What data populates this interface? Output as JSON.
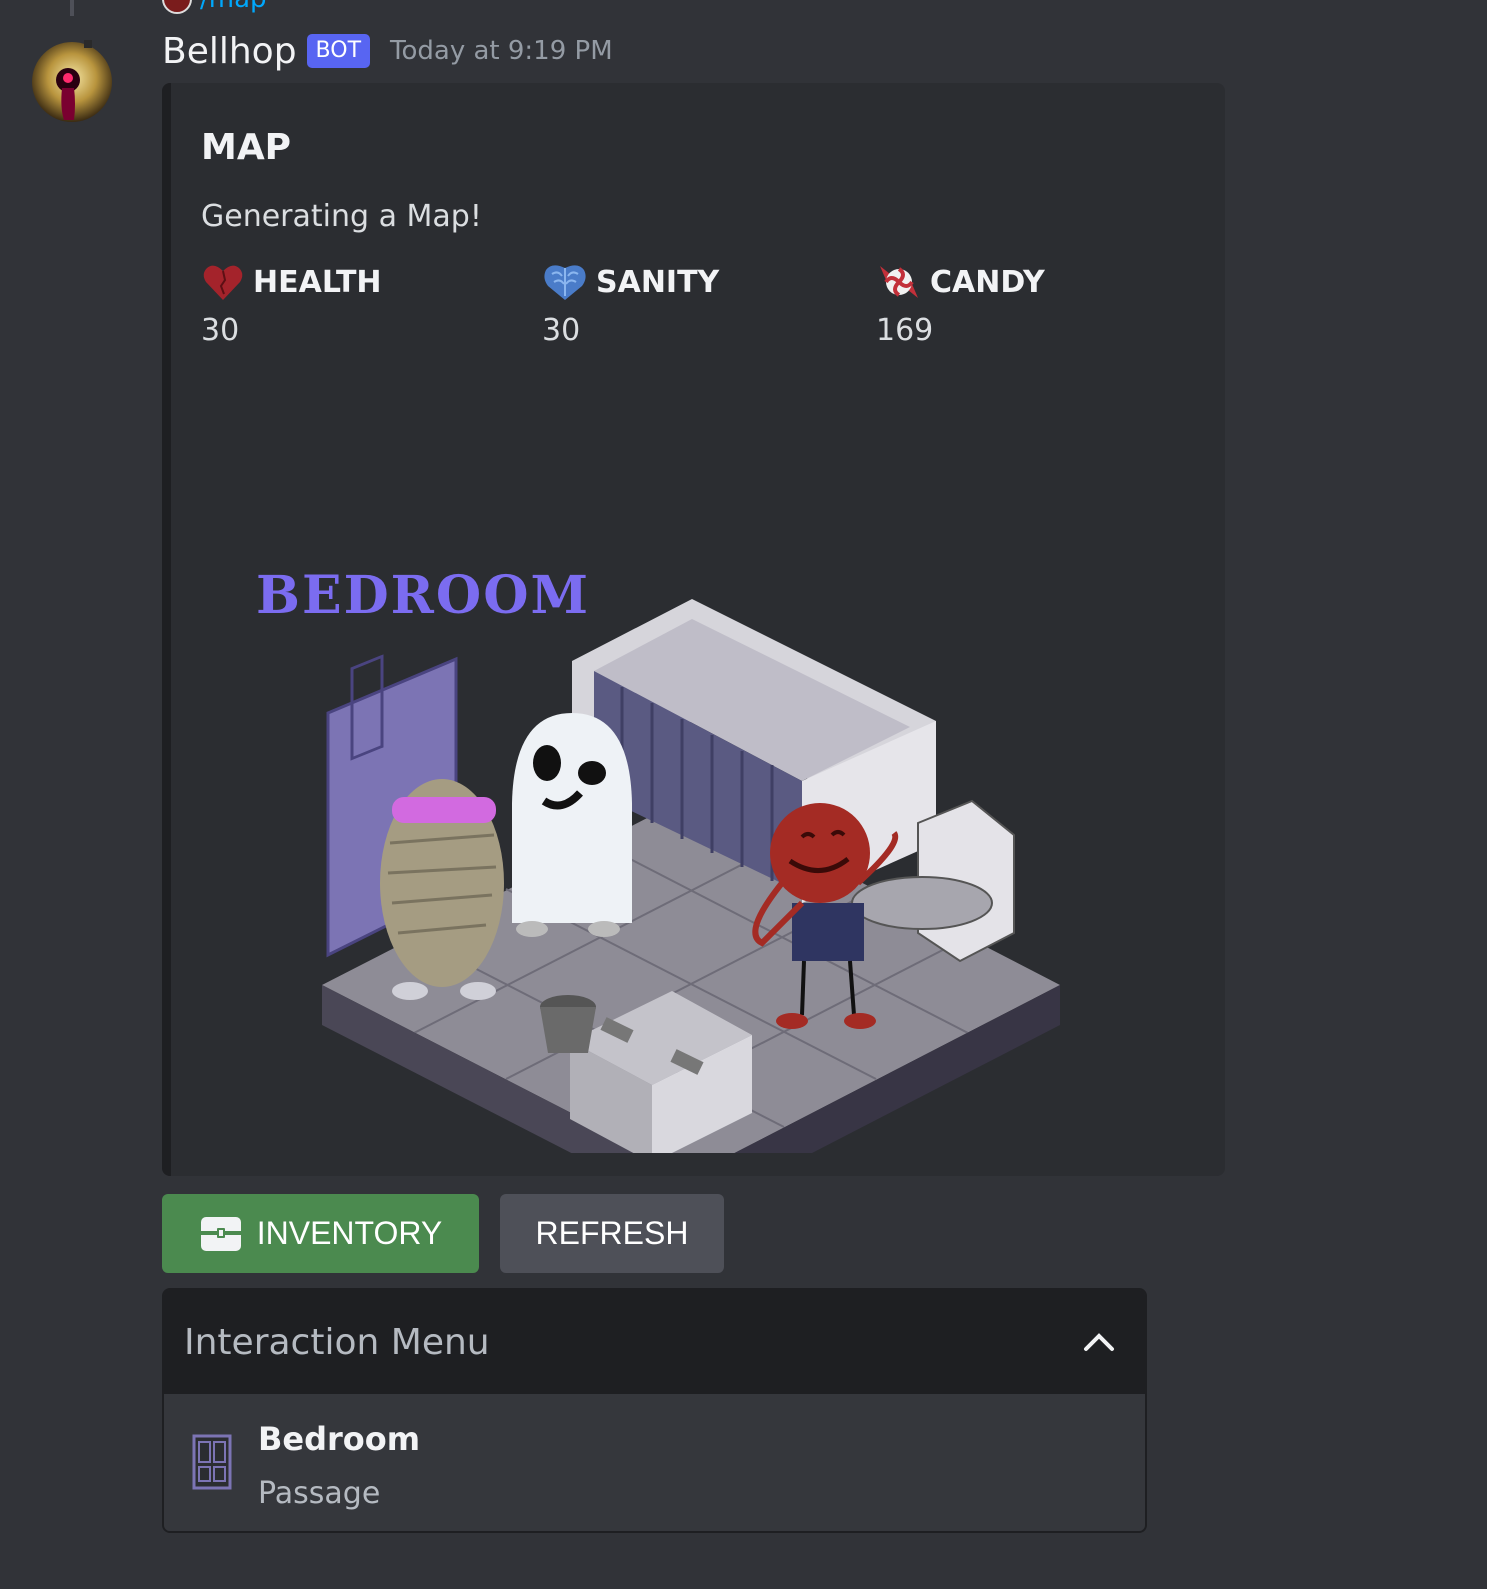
{
  "reply": {
    "command": "/map"
  },
  "message": {
    "username": "Bellhop",
    "bot_tag": "BOT",
    "timestamp": "Today at 9:19 PM"
  },
  "embed": {
    "title": "MAP",
    "description": "Generating a Map!",
    "fields": [
      {
        "name": "HEALTH",
        "value": "30",
        "icon": "heart-icon"
      },
      {
        "name": "SANITY",
        "value": "30",
        "icon": "brain-icon"
      },
      {
        "name": "CANDY",
        "value": "169",
        "icon": "candy-icon"
      }
    ],
    "image_text": "BEDROOM"
  },
  "buttons": {
    "inventory": "INVENTORY",
    "refresh": "REFRESH"
  },
  "select_menu": {
    "placeholder": "Interaction Menu",
    "options": [
      {
        "label": "Bedroom",
        "description": "Passage",
        "icon": "door-icon"
      }
    ]
  },
  "colors": {
    "background": "#313338",
    "embed": "#2b2d31",
    "bot_tag": "#5865f2",
    "inventory_button": "#4b8a4f",
    "refresh_button": "#4e5058",
    "map_title": "#7b6cf0"
  }
}
